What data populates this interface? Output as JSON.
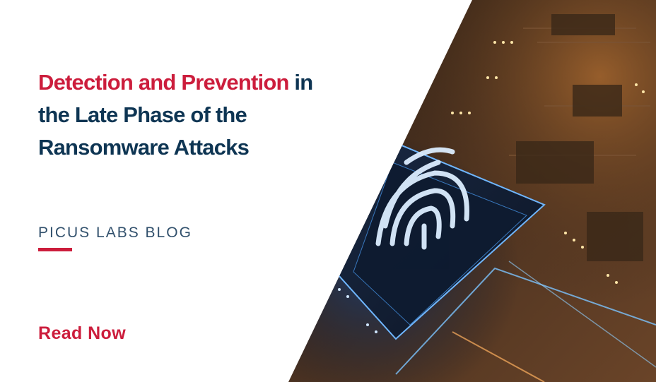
{
  "headline": {
    "accent": "Detection and Prevention",
    "connector": "in",
    "line2": "the Late Phase of the",
    "line3": "Ransomware Attacks"
  },
  "blog_label": "PICUS LABS BLOG",
  "cta": {
    "label": "Read Now"
  },
  "image": {
    "name": "fingerprint-chip-circuit-board"
  },
  "colors": {
    "accent": "#cc1d3c",
    "headline": "#0e3553",
    "label": "#31506c",
    "background": "#ffffff"
  }
}
